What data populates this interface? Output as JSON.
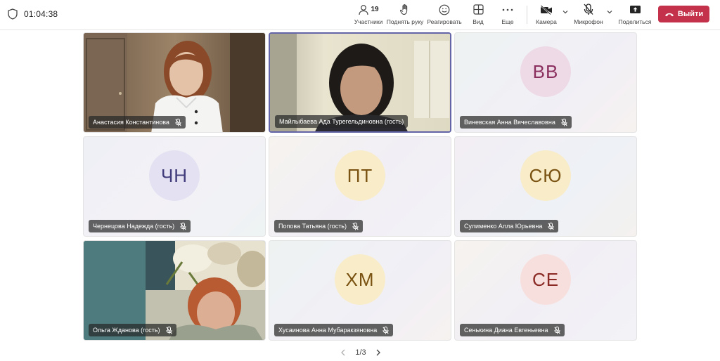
{
  "meeting": {
    "timer": "01:04:38"
  },
  "toolbar": {
    "participants": {
      "label": "Участники",
      "count": "19"
    },
    "raise_hand": {
      "label": "Поднять руку"
    },
    "react": {
      "label": "Реагировать"
    },
    "view": {
      "label": "Вид"
    },
    "more": {
      "label": "Еще"
    },
    "camera": {
      "label": "Камера"
    },
    "mic": {
      "label": "Микрофон"
    },
    "share": {
      "label": "Поделиться"
    },
    "leave": {
      "label": "Выйти"
    }
  },
  "tiles": [
    {
      "name": "Анастасия Константинова",
      "type": "video"
    },
    {
      "name": "Майлыбаева Ада Турегельдиновна (гость)",
      "type": "video",
      "active": true
    },
    {
      "name": "Виневская Анна Вячеславовна",
      "initials": "ВВ",
      "avatar_bg": "#eed9e6",
      "avatar_fg": "#8a2f5e"
    },
    {
      "name": "Чернецова Надежда (гость)",
      "initials": "ЧН",
      "avatar_bg": "#e4e1f2",
      "avatar_fg": "#403b7a"
    },
    {
      "name": "Попова Татьяна (гость)",
      "initials": "ПТ",
      "avatar_bg": "#f8ecc9",
      "avatar_fg": "#7a5212"
    },
    {
      "name": "Сулименко Алла Юрьевна",
      "initials": "СЮ",
      "avatar_bg": "#f8ecc9",
      "avatar_fg": "#7a5212"
    },
    {
      "name": "Ольга Жданова (гость)",
      "type": "video"
    },
    {
      "name": "Хусаинова Анна Мубаракзяновна",
      "initials": "ХМ",
      "avatar_bg": "#f8ecc9",
      "avatar_fg": "#7a5212"
    },
    {
      "name": "Сенькина Диана Евгеньевна",
      "initials": "СЕ",
      "avatar_bg": "#f7dfdd",
      "avatar_fg": "#8b2a25"
    }
  ],
  "pager": {
    "text": "1/3"
  },
  "colors": {
    "accent": "#6264a7",
    "leave": "#c4314b"
  }
}
